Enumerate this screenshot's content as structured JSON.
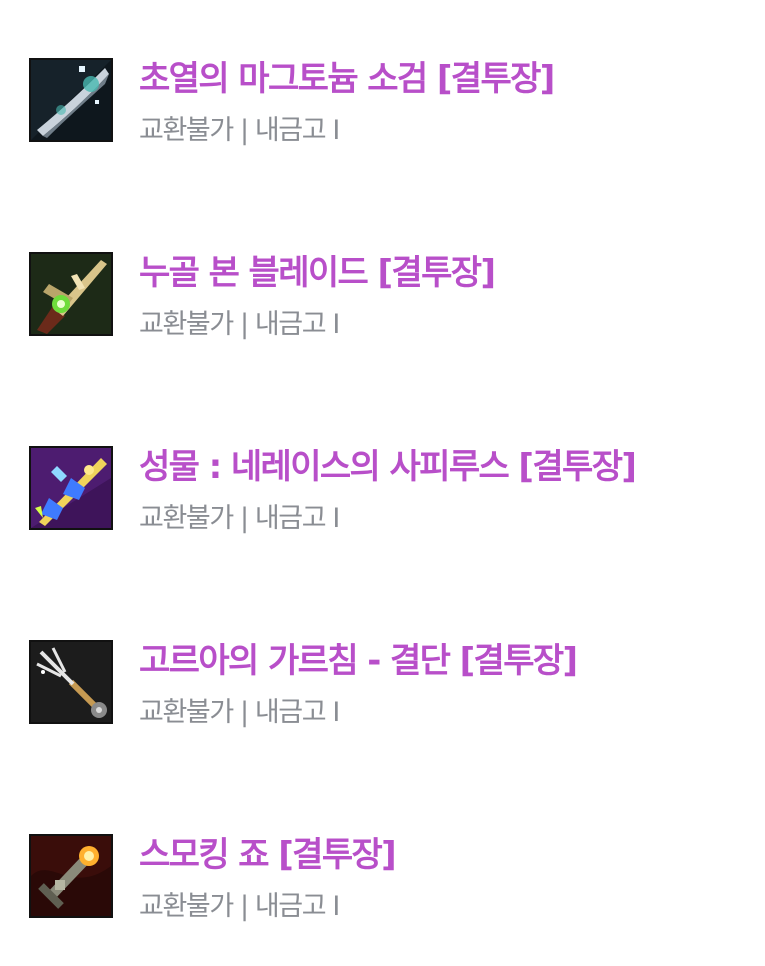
{
  "items": [
    {
      "name": "초열의 마그토늄 소검 [결투장]",
      "meta": "교환불가 | 내금고 I",
      "icon": "dagger-item-icon",
      "colors": {
        "bg": "#16222a",
        "accent": "#49b9b0",
        "metal": "#c9d3dc"
      }
    },
    {
      "name": "누골 본 블레이드 [결투장]",
      "meta": "교환불가 | 내금고 I",
      "icon": "bone-blade-item-icon",
      "colors": {
        "bg": "#1d2a17",
        "accent": "#6fdc3c",
        "metal": "#d9c58a"
      }
    },
    {
      "name": "성물 : 네레이스의 사피루스 [결투장]",
      "meta": "교환불가 | 내금고 I",
      "icon": "relic-staff-item-icon",
      "colors": {
        "bg": "#3e145a",
        "accent": "#3f7bff",
        "metal": "#f0d45a"
      }
    },
    {
      "name": "고르아의 가르침 - 결단 [결투장]",
      "meta": "교환불가 | 내금고 I",
      "icon": "trident-item-icon",
      "colors": {
        "bg": "#1c1c1c",
        "accent": "#e6e6e6",
        "metal": "#c69a52"
      }
    },
    {
      "name": "스모킹 죠 [결투장]",
      "meta": "교환불가 | 내금고 I",
      "icon": "smoking-pipe-item-icon",
      "colors": {
        "bg": "#3a0d0a",
        "accent": "#ffb02e",
        "metal": "#8a8a7a"
      }
    }
  ]
}
